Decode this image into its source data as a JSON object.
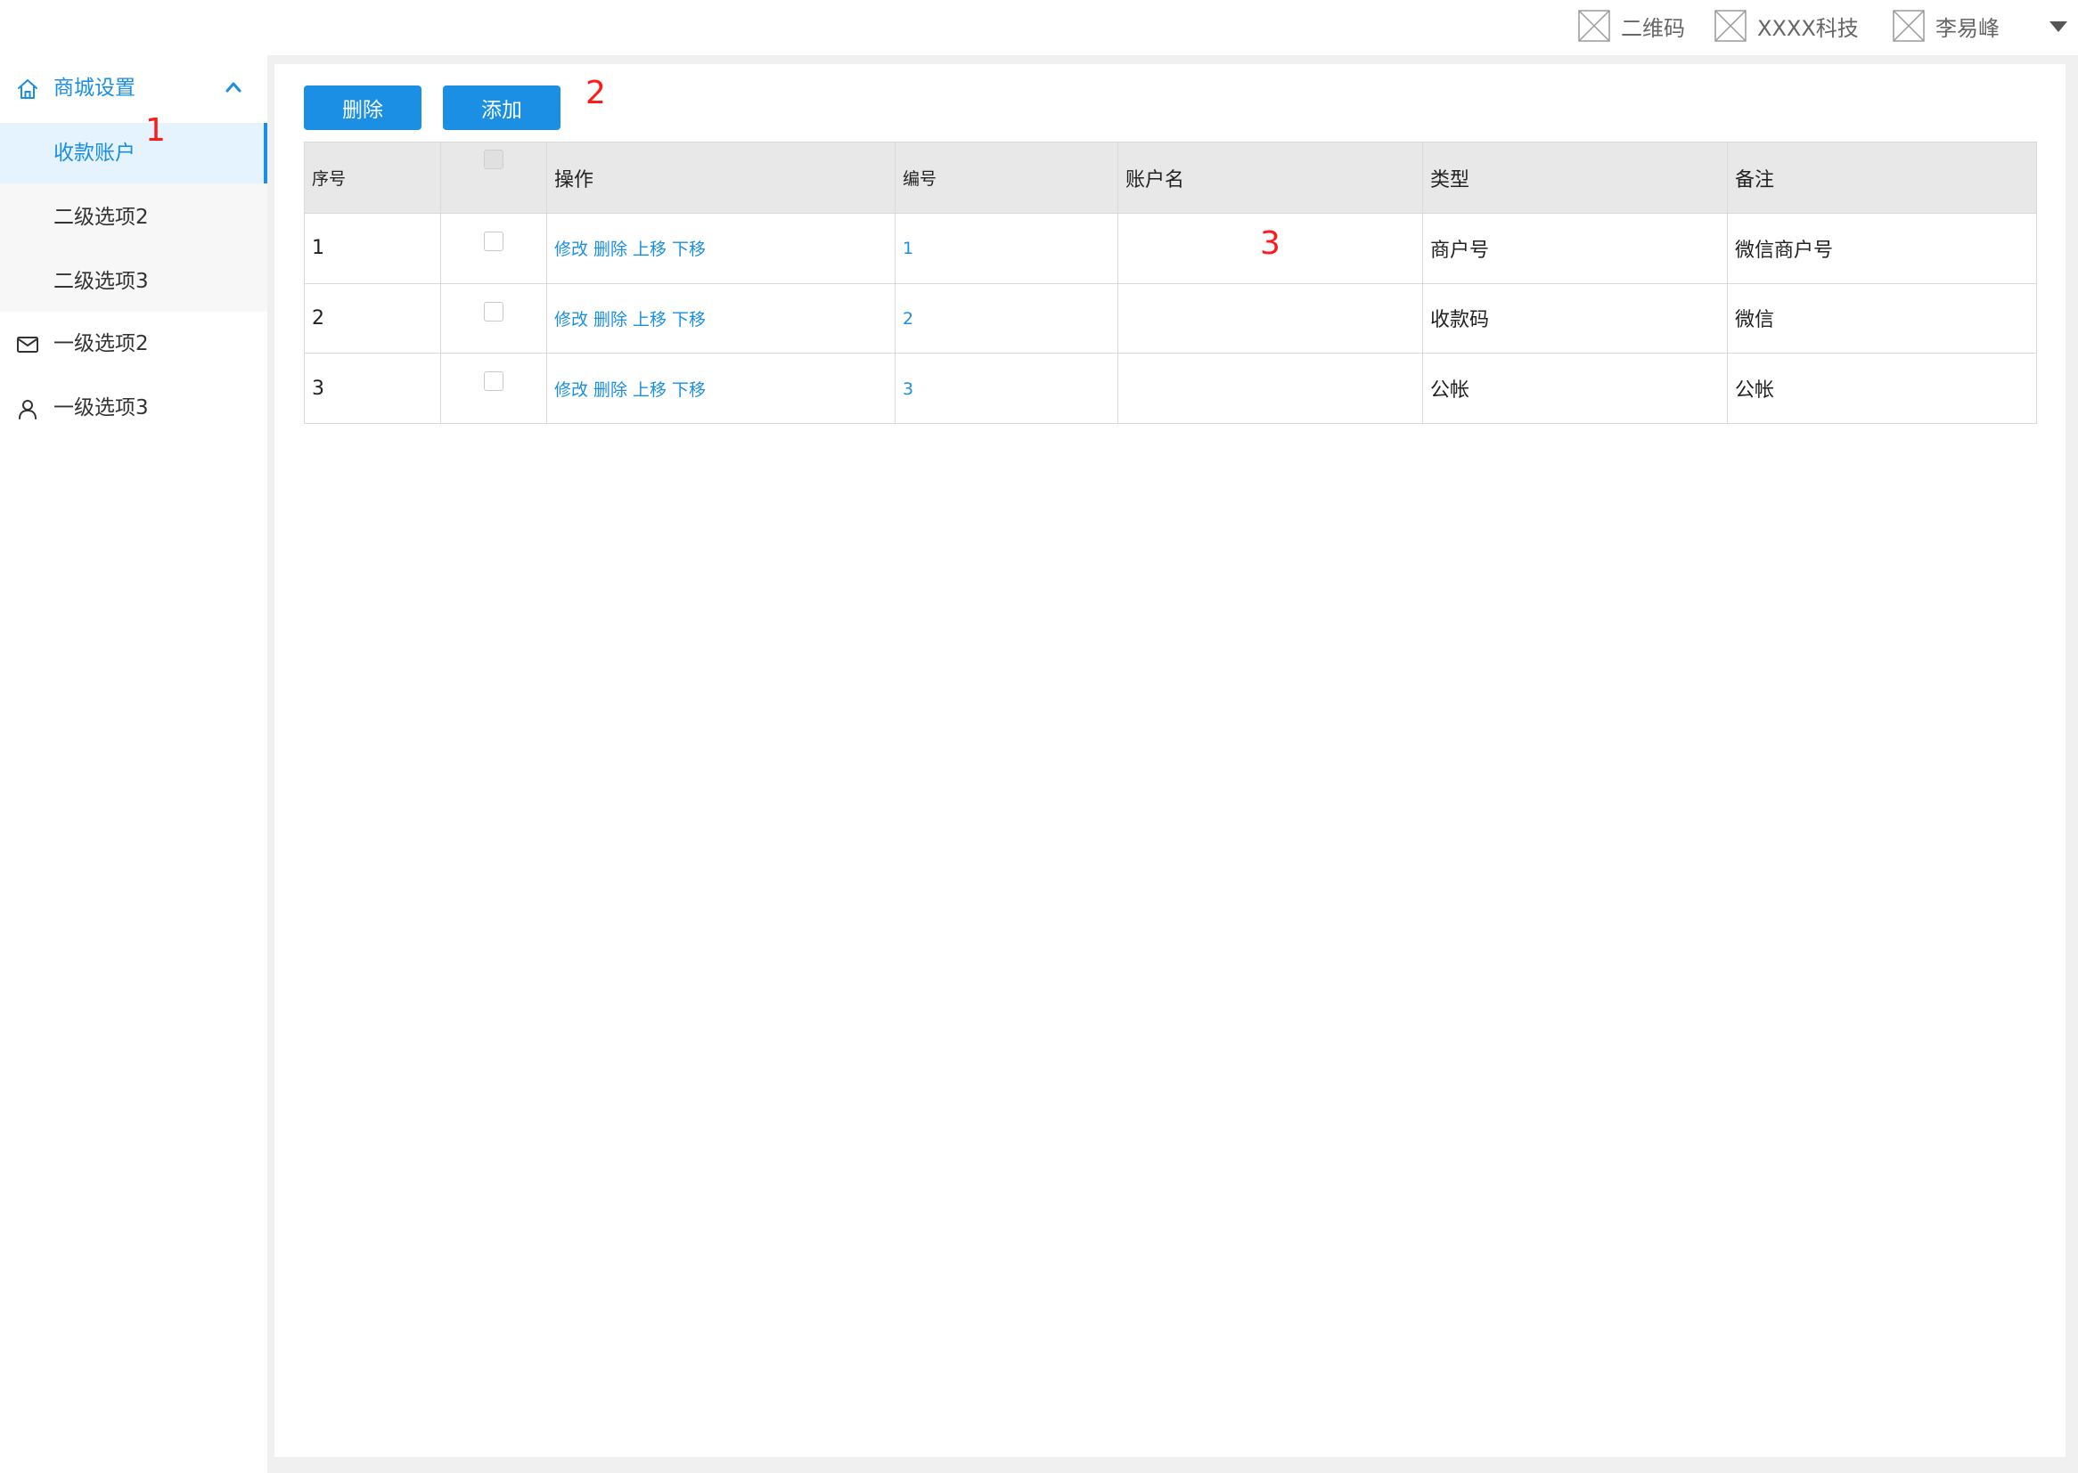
{
  "header": {
    "qrcode_label": "二维码",
    "company_label": "XXXX科技",
    "user_label": "李易峰"
  },
  "sidebar": {
    "groups": [
      {
        "label": "商城设置",
        "icon": "home-icon",
        "expanded": true,
        "children": [
          {
            "label": "收款账户",
            "active": true
          },
          {
            "label": "二级选项2",
            "active": false
          },
          {
            "label": "二级选项3",
            "active": false
          }
        ]
      },
      {
        "label": "一级选项2",
        "icon": "mail-icon"
      },
      {
        "label": "一级选项3",
        "icon": "user-icon"
      }
    ]
  },
  "toolbar": {
    "delete_label": "删除",
    "add_label": "添加"
  },
  "table": {
    "columns": [
      "序号",
      "",
      "操作",
      "编号",
      "账户名",
      "类型",
      "备注"
    ],
    "action_labels": [
      "修改",
      "删除",
      "上移",
      "下移"
    ],
    "rows": [
      {
        "index": "1",
        "code": "1",
        "account_name": "",
        "type": "商户号",
        "remark": "微信商户号"
      },
      {
        "index": "2",
        "code": "2",
        "account_name": "",
        "type": "收款码",
        "remark": "微信"
      },
      {
        "index": "3",
        "code": "3",
        "account_name": "",
        "type": "公帐",
        "remark": "公帐"
      }
    ]
  },
  "annotations": [
    "1",
    "2",
    "3"
  ],
  "colors": {
    "accent": "#1a8fe3",
    "annotation": "#ff1a1a",
    "table_header_bg": "#e8e8e8",
    "active_item_bg": "#e5f3ff"
  }
}
